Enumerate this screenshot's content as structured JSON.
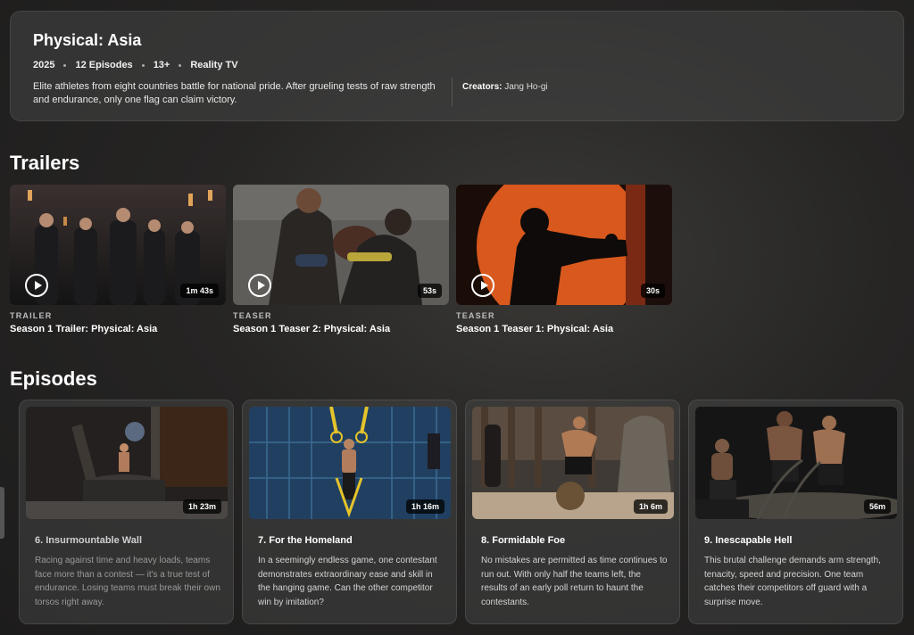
{
  "show": {
    "title": "Physical: Asia",
    "year": "2025",
    "episodes_count": "12 Episodes",
    "rating": "13+",
    "genre": "Reality TV",
    "description": "Elite athletes from eight countries battle for national pride. After grueling tests of raw strength and endurance, only one flag can claim victory.",
    "creators_label": "Creators:",
    "creators": "Jang Ho-gi"
  },
  "sections": {
    "trailers": "Trailers",
    "episodes": "Episodes"
  },
  "trailers": [
    {
      "kind": "TRAILER",
      "title": "Season 1 Trailer: Physical: Asia",
      "duration": "1m 43s",
      "thumb_color": "#2b2a2a"
    },
    {
      "kind": "TEASER",
      "title": "Season 1 Teaser 2: Physical: Asia",
      "duration": "53s",
      "thumb_color": "#5a5a57"
    },
    {
      "kind": "TEASER",
      "title": "Season 1 Teaser 1: Physical: Asia",
      "duration": "30s",
      "thumb_color": "#d9561a"
    }
  ],
  "episodes": [
    {
      "title": "6. Insurmountable Wall",
      "duration": "1h 23m",
      "description": "Racing against time and heavy loads, teams face more than a contest — it's a true test of endurance. Losing teams must break their own torsos right away."
    },
    {
      "title": "7. For the Homeland",
      "duration": "1h 16m",
      "description": "In a seemingly endless game, one contestant demonstrates extraordinary ease and skill in the hanging game. Can the other competitor win by imitation?"
    },
    {
      "title": "8. Formidable Foe",
      "duration": "1h 6m",
      "description": "No mistakes are permitted as time continues to run out. With only half the teams left, the results of an early poll return to haunt the contestants."
    },
    {
      "title": "9. Inescapable Hell",
      "duration": "56m",
      "description": "This brutal challenge demands arm strength, tenacity, speed and precision. One team catches their competitors off guard with a surprise move."
    }
  ],
  "icons": {
    "play": "play-circle-icon"
  }
}
